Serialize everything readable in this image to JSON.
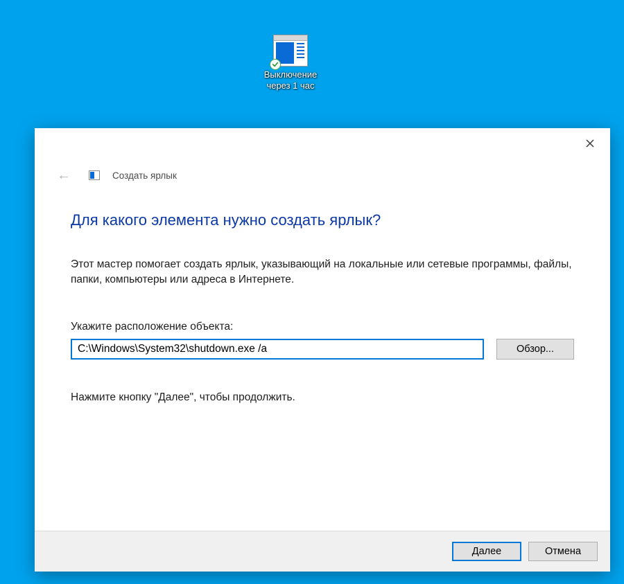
{
  "desktop": {
    "shortcut_label_line1": "Выключение",
    "shortcut_label_line2": "через 1 час"
  },
  "dialog": {
    "wizard_title": "Создать ярлык",
    "heading": "Для какого элемента нужно создать ярлык?",
    "description": "Этот мастер помогает создать ярлык, указывающий на локальные или сетевые программы, файлы, папки, компьютеры или адреса в Интернете.",
    "field_label": "Укажите расположение объекта:",
    "path_value": "C:\\Windows\\System32\\shutdown.exe /a",
    "browse_label": "Обзор...",
    "hint": "Нажмите кнопку \"Далее\", чтобы продолжить.",
    "next_label": "Далее",
    "cancel_label": "Отмена"
  },
  "colors": {
    "desktop_bg": "#00a2ed",
    "accent": "#0078d7",
    "heading": "#0b38a5"
  }
}
